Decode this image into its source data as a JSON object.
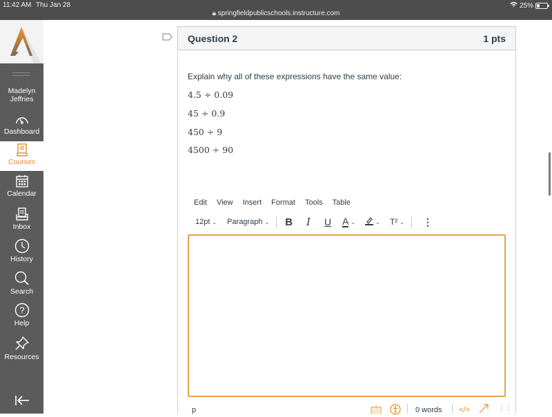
{
  "statusbar": {
    "time": "11:42 AM",
    "date": "Thu Jan 28",
    "url": "springfieldpublicschools.instructure.com",
    "battery_label": "25%",
    "battery_level": 0.25
  },
  "sidebar": {
    "brand_color": "#e58b26",
    "user_name_line1": "Madelyn",
    "user_name_line2": "Jeffries",
    "items": [
      {
        "label": "Dashboard",
        "icon": "dashboard-icon"
      },
      {
        "label": "Courses",
        "icon": "courses-icon",
        "active": true
      },
      {
        "label": "Calendar",
        "icon": "calendar-icon"
      },
      {
        "label": "Inbox",
        "icon": "inbox-icon"
      },
      {
        "label": "History",
        "icon": "history-icon"
      },
      {
        "label": "Search",
        "icon": "search-icon"
      },
      {
        "label": "Help",
        "icon": "help-icon"
      },
      {
        "label": "Resources",
        "icon": "pin-icon"
      }
    ],
    "collapse_icon": "collapse-arrow-icon"
  },
  "question": {
    "title": "Question 2",
    "points": "1 pts",
    "prompt": "Explain why all of these expressions have the same value:",
    "expressions": [
      "4.5 ÷ 0.09",
      "45 ÷ 0.9",
      "450 ÷ 9",
      "4500 ÷ 90"
    ]
  },
  "editor": {
    "menu": [
      "Edit",
      "View",
      "Insert",
      "Format",
      "Tools",
      "Table"
    ],
    "font_size": "12pt",
    "block_format": "Paragraph",
    "bold": "B",
    "italic": "I",
    "underline": "U",
    "text_color": "A",
    "superscript": "T²",
    "more": "⋮",
    "content": "",
    "path": "p",
    "word_count": "0 words",
    "html_toggle": "</>",
    "accent_color": "#e8a04f"
  }
}
